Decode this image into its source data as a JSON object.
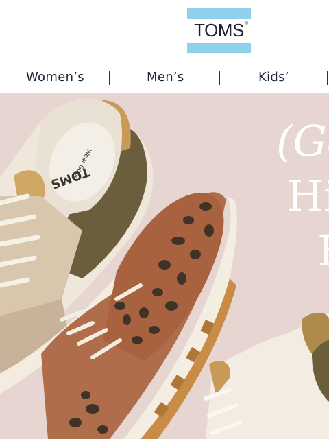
{
  "brand": {
    "logo_text": "TOMS",
    "logo_mark": "®",
    "band_color": "#8fd0ec"
  },
  "nav": {
    "items": [
      {
        "label": "Women’s"
      },
      {
        "label": "Men’s"
      },
      {
        "label": "Kids’"
      }
    ]
  },
  "hero": {
    "line1": "(Ge",
    "line2": "Hi",
    "line3": "F",
    "insole_text": "TOMS",
    "insole_sub": "Wear Good",
    "background_color": "#e6d5d0"
  }
}
